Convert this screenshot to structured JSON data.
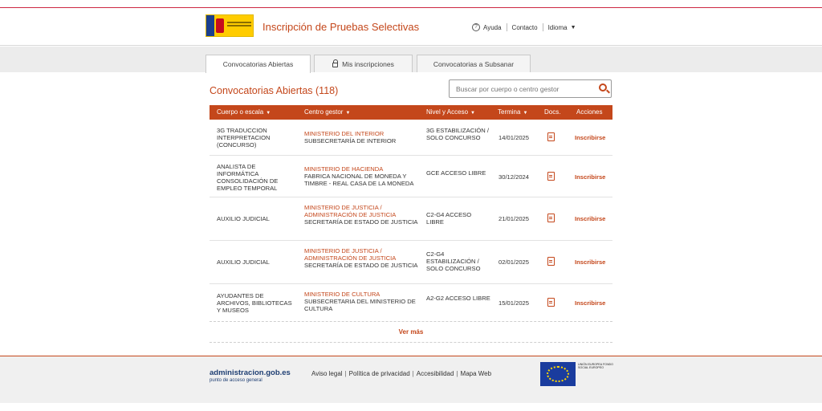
{
  "header": {
    "app_title": "Inscripción de Pruebas Selectivas",
    "logo_text": "GOBIERNO DE ESPAÑA",
    "nav": {
      "help": "Ayuda",
      "contact": "Contacto",
      "language": "Idioma"
    }
  },
  "tabs": [
    {
      "label": "Convocatorias Abiertas",
      "active": true
    },
    {
      "label": "Mis inscripciones",
      "icon": "lock-icon"
    },
    {
      "label": "Convocatorias a Subsanar"
    }
  ],
  "main": {
    "section_title": "Convocatorias Abiertas (118)",
    "search": {
      "placeholder": "Buscar por cuerpo o centro gestor",
      "value": ""
    },
    "columns": {
      "cuerpo": "Cuerpo o escala",
      "centro": "Centro gestor",
      "nivel": "Nivel y Acceso",
      "termina": "Termina",
      "docs": "Docs.",
      "acciones": "Acciones"
    },
    "rows": [
      {
        "cuerpo": "3G TRADUCCION INTERPRETACION (CONCURSO)",
        "organismo": "MINISTERIO DEL INTERIOR",
        "unidad": "SUBSECRETARÍA DE INTERIOR",
        "nivel": "3G ESTABILIZACIÓN / SOLO CONCURSO",
        "termina": "14/01/2025",
        "accion": "Inscribirse"
      },
      {
        "cuerpo": "ANALISTA DE INFORMÁTICA CONSOLIDACIÓN DE EMPLEO TEMPORAL",
        "organismo": "MINISTERIO DE HACIENDA",
        "unidad": "FABRICA NACIONAL DE MONEDA Y TIMBRE - REAL CASA DE LA MONEDA",
        "nivel": "GCE ACCESO LIBRE",
        "termina": "30/12/2024",
        "accion": "Inscribirse"
      },
      {
        "cuerpo": "AUXILIO JUDICIAL",
        "organismo": "MINISTERIO DE JUSTICIA / ADMINISTRACIÓN DE JUSTICIA",
        "unidad": "SECRETARÍA DE ESTADO DE JUSTICIA",
        "nivel": "C2-G4 ACCESO LIBRE",
        "termina": "21/01/2025",
        "accion": "Inscribirse"
      },
      {
        "cuerpo": "AUXILIO JUDICIAL",
        "organismo": "MINISTERIO DE JUSTICIA / ADMINISTRACIÓN DE JUSTICIA",
        "unidad": "SECRETARÍA DE ESTADO DE JUSTICIA",
        "nivel": "C2-G4 ESTABILIZACIÓN / SOLO CONCURSO",
        "termina": "02/01/2025",
        "accion": "Inscribirse"
      },
      {
        "cuerpo": "AYUDANTES DE ARCHIVOS, BIBLIOTECAS Y MUSEOS",
        "organismo": "MINISTERIO DE CULTURA",
        "unidad": "SUBSECRETARIA DEL MINISTERIO DE CULTURA",
        "nivel": "A2-G2 ACCESO LIBRE",
        "termina": "15/01/2025",
        "accion": "Inscribirse"
      }
    ],
    "more_label": "Ver más"
  },
  "footer": {
    "logo_main": "administracion.gob.es",
    "logo_sub": "punto de acceso general",
    "links": [
      "Aviso legal",
      "Política de privacidad",
      "Accesibilidad",
      "Mapa Web"
    ],
    "eu_text": "UNIÓN EUROPEA FONDO SOCIAL EUROPEO"
  },
  "colors": {
    "accent": "#c4471b",
    "header_band": "#ececec",
    "footer_bg": "#f0f0f0"
  }
}
